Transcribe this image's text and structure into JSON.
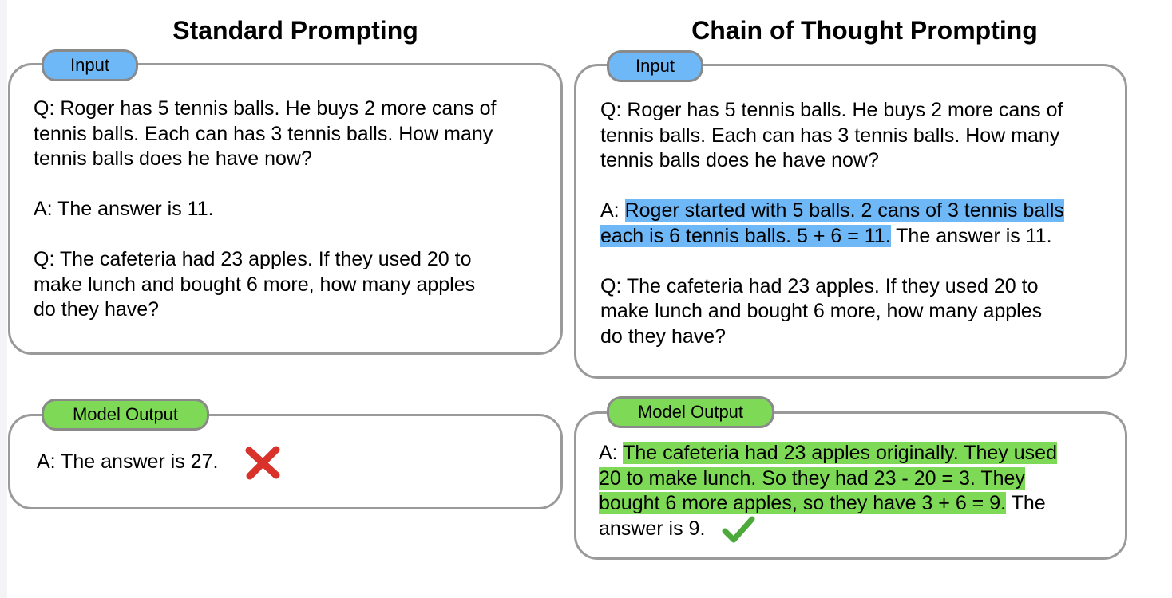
{
  "standard": {
    "title": "Standard Prompting",
    "input_label": "Input",
    "q1": [
      "Q: Roger has 5 tennis balls. He buys 2 more cans of",
      "tennis balls. Each can has 3 tennis balls. How many",
      "tennis balls does he have now?"
    ],
    "a1": "A: The answer is 11.",
    "q2": [
      "Q: The cafeteria had 23 apples. If they used 20 to",
      "make lunch and bought 6 more, how many apples",
      "do they have?"
    ],
    "output_label": "Model Output",
    "output_text": "A: The answer is 27.",
    "output_mark": "cross-icon"
  },
  "cot": {
    "title": "Chain of Thought Prompting",
    "input_label": "Input",
    "q1": [
      "Q: Roger has 5 tennis balls. He buys 2 more cans of",
      "tennis balls. Each can has 3 tennis balls. How many",
      "tennis balls does he have now?"
    ],
    "a1_prefix": "A: ",
    "a1_highlight_1": "Roger started with 5 balls. 2 cans of 3 tennis balls",
    "a1_highlight_2": "each is 6 tennis balls. 5 + 6 = 11.",
    "a1_suffix": " The answer is 11.",
    "q2": [
      "Q: The cafeteria had 23 apples. If they used 20 to",
      "make lunch and bought 6 more, how many apples",
      "do they have?"
    ],
    "output_label": "Model Output",
    "output_prefix": "A: ",
    "output_highlight_1": "The cafeteria had 23 apples originally. They used",
    "output_highlight_2": "20 to make lunch. So they had 23 - 20 = 3. They",
    "output_highlight_3": "bought 6 more apples, so they have 3 + 6 = 9.",
    "output_suffix": " The",
    "output_line4": "answer is 9.",
    "output_mark": "check-icon"
  },
  "colors": {
    "input_blue": "#6eb8f7",
    "output_green": "#7ed957",
    "cross_red": "#d8322a",
    "check_green": "#4caa3a",
    "border_gray": "#9a9a9a"
  }
}
